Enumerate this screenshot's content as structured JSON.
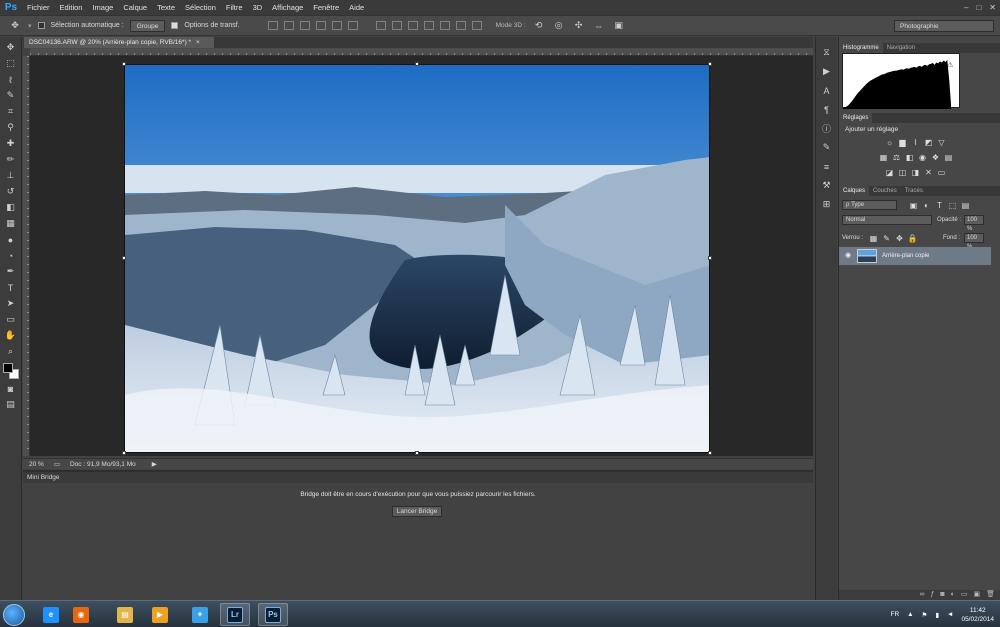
{
  "app": {
    "logo": "Ps",
    "menu": [
      "Fichier",
      "Edition",
      "Image",
      "Calque",
      "Texte",
      "Sélection",
      "Filtre",
      "3D",
      "Affichage",
      "Fenêtre",
      "Aide"
    ],
    "window_controls": [
      "–",
      "□",
      "✕"
    ]
  },
  "options_bar": {
    "auto_select_label": "Sélection automatique :",
    "auto_select_value": "Groupe",
    "transform_label": "Options de transf.",
    "mode3d_label": "Mode 3D :",
    "workspace": "Photographie"
  },
  "document": {
    "tab_title": "DSC04136.ARW @ 20% (Arrière-plan copie, RVB/16*) *",
    "tab_close": "×"
  },
  "status_bar": {
    "zoom": "20 %",
    "doc_info": "Doc : 91,9 Mo/93,1 Mo"
  },
  "mini_bridge": {
    "tab": "Mini Bridge",
    "message": "Bridge doit être en cours d'exécution pour que vous puissiez parcourir les fichiers.",
    "button": "Lancer Bridge"
  },
  "panels": {
    "top_tabs": [
      "Histogramme",
      "Navigation"
    ],
    "adjust_tab": "Réglages",
    "adjust_title": "Ajouter un réglage",
    "layer_tabs": [
      "Calques",
      "Couches",
      "Tracés"
    ],
    "layer_filter": "ρ Type",
    "blend_mode": "Normal",
    "opacity_label": "Opacité :",
    "opacity_value": "100 %",
    "lock_label": "Verrou :",
    "fill_label": "Fond :",
    "fill_value": "100 %",
    "layer_name": "Arrière-plan copie"
  },
  "histogram": {
    "values": [
      0.02,
      0.03,
      0.05,
      0.08,
      0.12,
      0.17,
      0.22,
      0.27,
      0.32,
      0.36,
      0.4,
      0.44,
      0.48,
      0.52,
      0.55,
      0.58,
      0.6,
      0.62,
      0.64,
      0.66,
      0.68,
      0.7,
      0.71,
      0.72,
      0.74,
      0.75,
      0.76,
      0.77,
      0.78,
      0.78,
      0.79,
      0.8,
      0.81,
      0.8,
      0.82,
      0.83,
      0.82,
      0.84,
      0.85,
      0.86,
      0.84,
      0.87,
      0.88,
      0.86,
      0.89,
      0.9,
      0.88,
      0.91,
      0.92,
      0.94,
      0.9,
      0.95,
      0.93,
      0.97,
      0.95,
      0.99,
      0.96,
      1.0,
      0.6,
      0.1
    ]
  },
  "taskbar": {
    "lang": "FR",
    "time": "11:42",
    "date": "05/02/2014",
    "apps": [
      {
        "name": "internet-explorer",
        "label": "e",
        "color": "#1e90ff"
      },
      {
        "name": "firefox",
        "label": "◉",
        "color": "#e8660d"
      },
      {
        "name": "file-explorer",
        "label": "▤",
        "color": "#e2b64a"
      },
      {
        "name": "media-player",
        "label": "▶",
        "color": "#f0a020"
      },
      {
        "name": "app-blue",
        "label": "✦",
        "color": "#3aa0e8"
      },
      {
        "name": "lightroom",
        "label": "Lr",
        "color": "#0b1d2e"
      },
      {
        "name": "photoshop",
        "label": "Ps",
        "color": "#0b1d2e"
      }
    ]
  }
}
